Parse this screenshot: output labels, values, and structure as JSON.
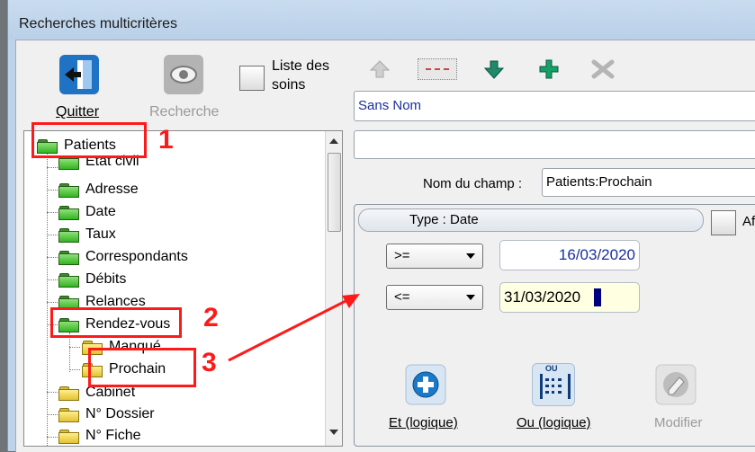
{
  "window": {
    "title": "Recherches multicritères"
  },
  "toolbar": {
    "quit_label": "Quitter",
    "search_label": "Recherche",
    "care_list_label_line1": "Liste des",
    "care_list_label_line2": "soins"
  },
  "tree": {
    "items": [
      {
        "label": "Patients"
      },
      {
        "label": "Etat civil"
      },
      {
        "label": "Adresse"
      },
      {
        "label": "Date"
      },
      {
        "label": "Taux"
      },
      {
        "label": "Correspondants"
      },
      {
        "label": "Débits"
      },
      {
        "label": "Relances"
      },
      {
        "label": "Rendez-vous"
      },
      {
        "label": "Manqué"
      },
      {
        "label": "Prochain"
      },
      {
        "label": "Cabinet"
      },
      {
        "label": "N° Dossier"
      },
      {
        "label": "N° Fiche"
      }
    ]
  },
  "search": {
    "name_value": "Sans Nom",
    "second_value": ""
  },
  "field": {
    "label": "Nom du champ :",
    "value": "Patients:Prochain",
    "type_label": "Type :  Date",
    "affi_label": "Affi"
  },
  "criteria": [
    {
      "operator": ">=",
      "value": "16/03/2020"
    },
    {
      "operator": "<=",
      "value": "31/03/2020"
    }
  ],
  "actions": {
    "and_label": "Et (logique)",
    "or_label": "Ou (logique)",
    "modify_label": "Modifier",
    "or_icon_text": "OU"
  },
  "annotations": {
    "n1": "1",
    "n2": "2",
    "n3": "3"
  },
  "colors": {
    "accent_red": "#ff1a1a",
    "folder_green": "#31b51f",
    "folder_yellow": "#e3c232",
    "input_yellow": "#ffffe1"
  }
}
